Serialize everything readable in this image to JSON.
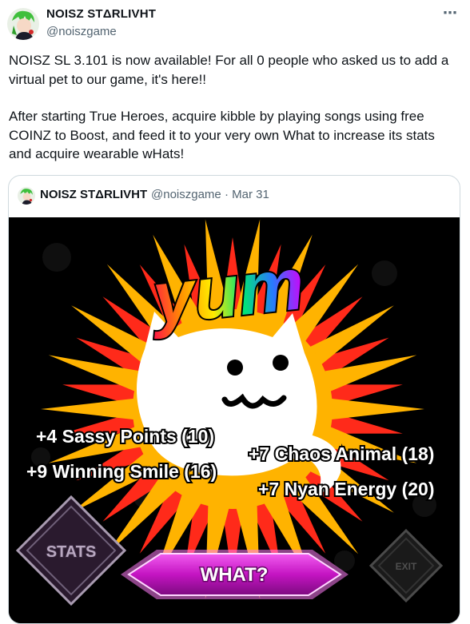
{
  "tweet": {
    "author_name": "NOISZ STΔRLIVHT",
    "author_handle": "@noiszgame",
    "more_icon": "⋯",
    "paragraphs": [
      "NOISZ SL 3.101 is now available! For all 0 people who asked us to add a virtual pet to our game, it's here!!",
      "After starting True Heroes, acquire kibble by playing songs using free COINZ to Boost, and feed it to your very own What to increase its stats and acquire wearable wHats!"
    ]
  },
  "quote": {
    "author_name": "NOISZ STΔRLIVHT",
    "author_handle": "@noiszgame",
    "separator": "·",
    "date": "Mar 31"
  },
  "game": {
    "yum_text": "yum",
    "stats_left": [
      "+4 Sassy Points (10)",
      "+9 Winning Smile (16)"
    ],
    "stats_right": [
      "+7 Chaos Animal (18)",
      "+7 Nyan Energy (20)"
    ],
    "stats_button": "STATS",
    "what_button": "WHAT?",
    "exit_button": "EXIT"
  },
  "colors": {
    "accent_gray": "#536471",
    "border": "#cfd9de",
    "sun_orange": "#ffb300",
    "sun_red": "#ff2a1a",
    "what_button_magenta": "#d21fd0"
  }
}
